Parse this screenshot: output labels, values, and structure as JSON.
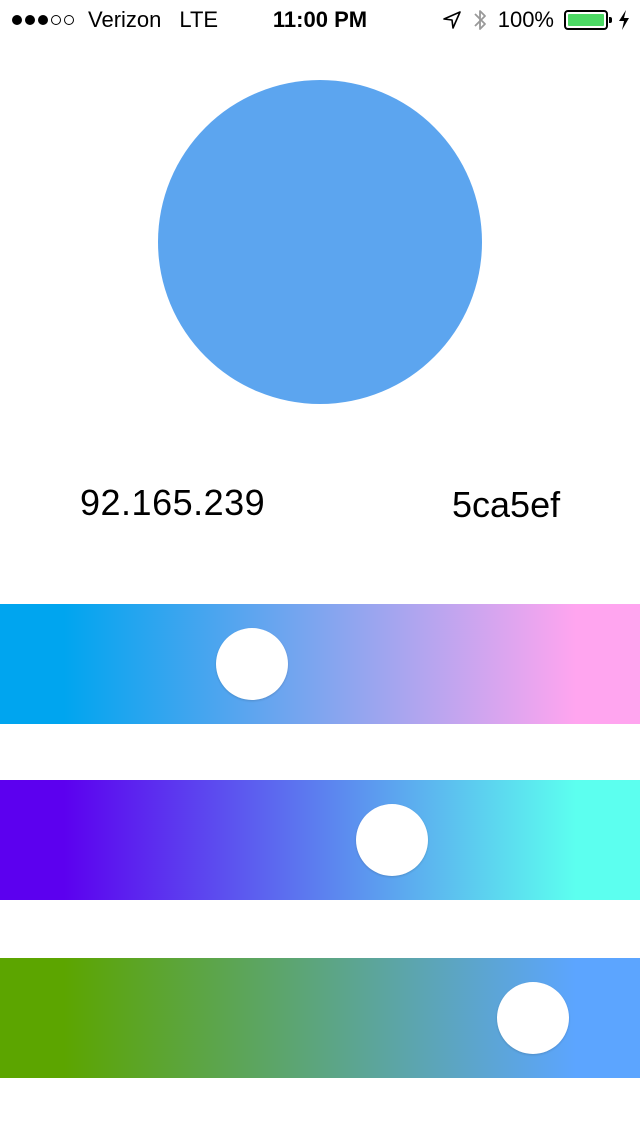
{
  "status_bar": {
    "signal_bars_filled": 3,
    "signal_bars_total": 5,
    "carrier": "Verizon",
    "network": "LTE",
    "time": "11:00 PM",
    "battery_percent_text": "100%",
    "battery_level": 1.0,
    "icons": [
      "location-arrow-icon",
      "bluetooth-icon",
      "battery-icon",
      "charging-bolt-icon"
    ]
  },
  "preview": {
    "color": "#5ca5ef",
    "rgb_text": "92.165.239",
    "hex_text": "5ca5ef"
  },
  "sliders": [
    {
      "channel": "red",
      "value": 92,
      "max": 255,
      "gradient_start": "#00a5ef",
      "gradient_end": "#ffa5ef"
    },
    {
      "channel": "green",
      "value": 165,
      "max": 255,
      "gradient_start": "#5c00ef",
      "gradient_end": "#5cffef"
    },
    {
      "channel": "blue",
      "value": 239,
      "max": 255,
      "gradient_start": "#5ca500",
      "gradient_end": "#5ca5ff"
    }
  ]
}
